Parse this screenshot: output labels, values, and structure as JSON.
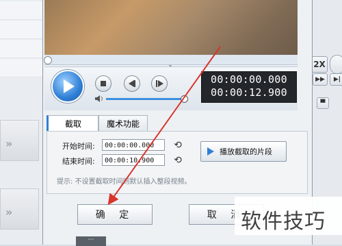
{
  "player": {
    "current_time": "00:00:00.000",
    "total_time": "00:00:12.900"
  },
  "speed_button": "2X",
  "tabs": [
    {
      "label": "截取"
    },
    {
      "label": "魔术功能"
    }
  ],
  "clip": {
    "start_label": "开始时间:",
    "start_value": "00:00:00.000",
    "end_label": "结束时间:",
    "end_value": "00:00:10.900",
    "play_clip_label": "播放截取的片段",
    "hint": "提示: 不设置截取时间则默认插入整段视频。"
  },
  "buttons": {
    "ok": "确 定",
    "cancel": "取 消"
  },
  "watermark": "软件技巧",
  "colors": {
    "accent": "#2f7fd6",
    "annotation_arrow": "#d9342b"
  }
}
